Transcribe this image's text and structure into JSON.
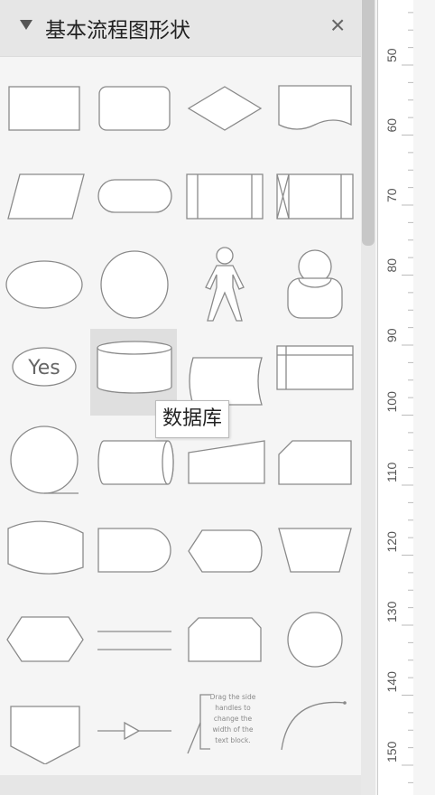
{
  "panel": {
    "title": "基本流程图形状",
    "close_label": "×"
  },
  "tooltip": {
    "text": "数据库"
  },
  "shapes": [
    "rectangle",
    "rounded-rectangle",
    "diamond",
    "document",
    "parallelogram",
    "terminator",
    "process",
    "internal-storage",
    "ellipse",
    "circle",
    "actor",
    "user",
    "yes-ellipse",
    "database",
    "stored-data",
    "table",
    "sequential-data",
    "direct-data",
    "manual-input",
    "card",
    "tape",
    "delay",
    "display",
    "manual-operation",
    "hexagon",
    "parallel-mode",
    "loop-limit",
    "connector",
    "off-page-reference",
    "or-arrow",
    "annotation",
    "arc"
  ],
  "yes_label": "Yes",
  "annotation_text": [
    "Drag the side",
    "handles to",
    "change the",
    "width of the",
    "text block."
  ],
  "ruler": {
    "labels": [
      "50",
      "60",
      "70",
      "80",
      "90",
      "100",
      "110",
      "120",
      "130",
      "140",
      "150"
    ]
  }
}
